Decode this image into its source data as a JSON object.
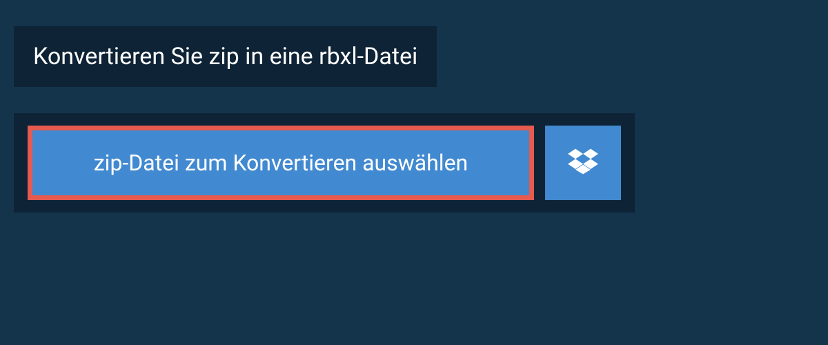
{
  "header": {
    "title": "Konvertieren Sie zip in eine rbxl-Datei"
  },
  "actions": {
    "select_file_label": "zip-Datei zum Konvertieren auswählen",
    "dropbox_icon": "dropbox"
  },
  "colors": {
    "page_bg": "#14344c",
    "panel_bg": "#0e2335",
    "button_bg": "#4189d0",
    "button_border": "#e65a4f",
    "text": "#ffffff"
  }
}
